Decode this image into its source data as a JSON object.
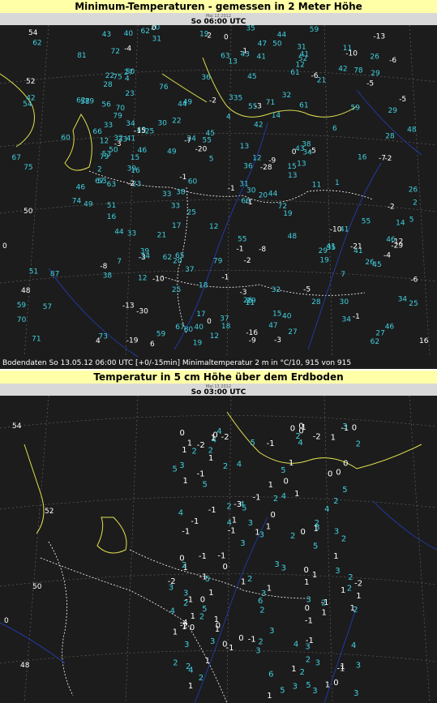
{
  "top_panel": {
    "title": "Minimum-Temperaturen - gemessen in 2 Meter Höhe",
    "date_tiny": "Mai 13 2012",
    "time": "So 06:00 UTC",
    "footer": "Bodendaten   So 13.05.12 06:00 UTC [+0/-15min]   Minimaltemperatur 2 m in °C/10, 915 von 915",
    "lat_labels": [
      "54",
      "52",
      "50",
      "48"
    ],
    "lon_labels": [
      "0",
      "4",
      "6",
      "16"
    ]
  },
  "bottom_panel": {
    "title": "Temperatur in 5 cm Höhe über dem Erdboden",
    "date_tiny": "Mai 13 2012",
    "time": "So 03:00 UTC",
    "lat_labels": [
      "54",
      "52",
      "50",
      "48"
    ],
    "lon_labels": [
      "0"
    ]
  },
  "colors": {
    "background": "#1c1c1c",
    "title_bar": "#ffffa8",
    "station_values": "#40d0e0",
    "frost_values": "#ffffff",
    "coastline_yellow": "#e0e050",
    "rivers_blue": "#2040c0"
  },
  "top_station_values": [
    "49",
    "54",
    "46",
    "59",
    "79",
    "87",
    "72",
    "79",
    "75",
    "67",
    "62",
    "59",
    "75",
    "76",
    "74",
    "79",
    "71",
    "62",
    "66",
    "51",
    "60",
    "70",
    "57",
    "58",
    "53",
    "33",
    "42",
    "81",
    "67",
    "44",
    "48",
    "31",
    "-3",
    "36",
    "49",
    "42",
    "37",
    "27",
    "34",
    "41",
    "44",
    "55",
    "49",
    "19",
    "80",
    "12",
    "15",
    "-19",
    "11",
    "13",
    "12",
    "29",
    "22",
    "35",
    "28",
    "25",
    "31",
    "40",
    "32",
    "29",
    "47",
    "60",
    "33",
    "22",
    "78",
    "20",
    "41",
    "13",
    "12",
    "-8",
    "-2",
    "0",
    "-10",
    "-7",
    "-13",
    "-4",
    "30",
    "16",
    "13",
    "15",
    "-9",
    "-30",
    "11",
    "-12",
    "-16",
    "-2",
    "-8",
    "-1",
    "-3",
    "-5",
    "-1",
    "2",
    "-5",
    "7",
    "-28",
    "-4",
    "-3",
    "-9",
    "-6",
    "21",
    "33",
    "19",
    "26",
    "50",
    "21",
    "20",
    "17",
    "0",
    "-5",
    "5",
    "-2",
    "4",
    "-3",
    "-1",
    "-2",
    "7",
    "-1",
    "-6",
    "3",
    "0",
    "-3",
    "-13",
    "14",
    "-2",
    "1",
    "17",
    "46",
    "18",
    "16",
    "23",
    "34",
    "27",
    "24",
    "36",
    "14",
    "41",
    "25",
    "39",
    "5",
    "45",
    "72",
    "46",
    "26",
    "44",
    "43",
    "50",
    "37",
    "34",
    "26",
    "43",
    "28",
    "44",
    "32",
    "12",
    "55",
    "50",
    "45",
    "42",
    "38",
    "32",
    "48",
    "41",
    "53",
    "35",
    "52",
    "34",
    "55",
    "25",
    "0",
    "62",
    "45",
    "40",
    "33",
    "31",
    "38",
    "40",
    "61",
    "29",
    "56",
    "49",
    "70",
    "20",
    "47",
    "41",
    "27",
    "25",
    "-15",
    "15",
    "18",
    "30",
    "46",
    "79",
    "55",
    "59",
    "13",
    "29",
    "23",
    "35",
    "-21",
    "62",
    "16",
    "11",
    "4",
    "2",
    "6",
    "63",
    "66",
    "38",
    "-1",
    "-10",
    "-6",
    "-5",
    "-20",
    "-29",
    "-7",
    "-1",
    "-10",
    "19",
    "12",
    "39",
    "63",
    "71",
    "73",
    "61",
    "67",
    "65",
    "34",
    "26",
    "62",
    "30",
    "59",
    "28",
    "19",
    "43",
    "33",
    "12",
    "-1",
    "-2",
    "51",
    "41"
  ],
  "bottom_station_values": [
    "1",
    "3",
    "2",
    "4",
    "5",
    "3",
    "1",
    "4",
    "2",
    "5",
    "3",
    "0",
    "1",
    "1",
    "0",
    "2",
    "3",
    "3",
    "4",
    "5",
    "0",
    "1",
    "-1",
    "1",
    "0",
    "2",
    "3",
    "1",
    "1",
    "5",
    "6",
    "4",
    "1",
    "0",
    "1",
    "1",
    "0",
    "-1",
    "2",
    "1",
    "0",
    "1",
    "0",
    "-1",
    "-1",
    "0",
    "1",
    "1",
    "2",
    "-1",
    "-2",
    "-3",
    "-1",
    "0",
    "-1",
    "1",
    "1",
    "0",
    "-1",
    "-2",
    "1",
    "2",
    "0",
    "3",
    "-1",
    "-1",
    "2",
    "0",
    "-1",
    "-4",
    "0",
    "-2",
    "3",
    "2",
    "1",
    "0",
    "-1",
    "0",
    "-1",
    "0",
    "1",
    "5",
    "2",
    "4",
    "3",
    "2",
    "1",
    "3",
    "2",
    "1",
    "3",
    "4",
    "5",
    "2",
    "0",
    "1",
    "3",
    "2",
    "4",
    "1",
    "2",
    "2",
    "3",
    "4",
    "2",
    "1",
    "3",
    "5",
    "2",
    "3",
    "1",
    "3",
    "4",
    "2",
    "3",
    "5",
    "2",
    "4",
    "3",
    "5",
    "-2",
    "1",
    "-1",
    "0",
    "-1",
    "-2",
    "1",
    "2",
    "-2",
    "1",
    "-1",
    "0",
    "1",
    "-1",
    "2",
    "3",
    "1",
    "0",
    "1",
    "-1",
    "0",
    "1",
    "2",
    "1",
    "5",
    "4",
    "3",
    "2",
    "6",
    "3",
    "5",
    "3",
    "1",
    "4",
    "2",
    "3",
    "4",
    "1",
    "3",
    "2"
  ]
}
